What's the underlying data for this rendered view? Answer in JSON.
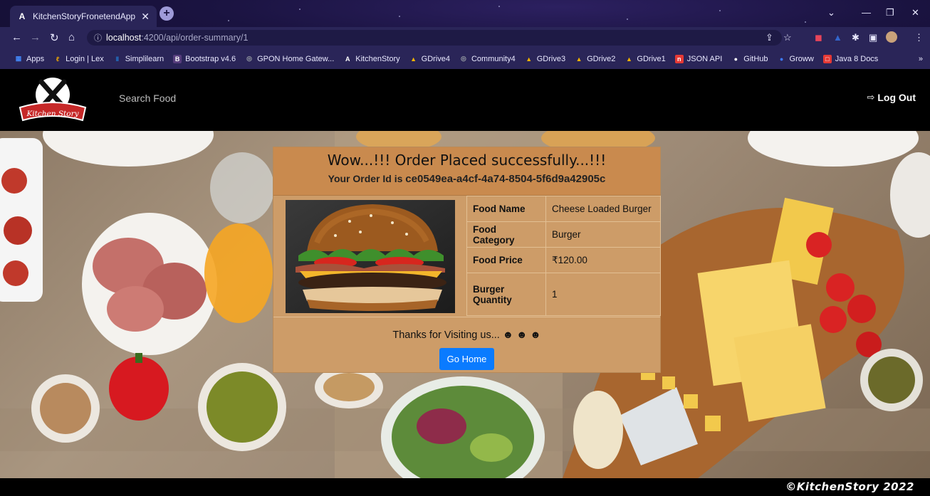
{
  "browser": {
    "tab_title": "KitchenStoryFronetendApp",
    "tab_favicon": "A",
    "url_host": "localhost",
    "url_path": ":4200/api/order-summary/1",
    "bookmarks": [
      {
        "label": "Apps",
        "icon": "apps-grid-icon",
        "color": "#4285f4"
      },
      {
        "label": "Login | Lex",
        "icon": "lex-icon",
        "color": "#f2a900"
      },
      {
        "label": "Simplilearn",
        "icon": "simplilearn-icon",
        "color": "#1e88e5"
      },
      {
        "label": "Bootstrap v4.6",
        "icon": "bootstrap-icon",
        "color": "#563d7c"
      },
      {
        "label": "GPON Home Gatew...",
        "icon": "globe-icon",
        "color": "#9aa0a6"
      },
      {
        "label": "KitchenStory",
        "icon": "angular-icon",
        "color": "#1a1340"
      },
      {
        "label": "GDrive4",
        "icon": "gdrive-icon",
        "color": "#0f9d58"
      },
      {
        "label": "Community4",
        "icon": "globe-icon",
        "color": "#9aa0a6"
      },
      {
        "label": "GDrive3",
        "icon": "gdrive-icon",
        "color": "#0f9d58"
      },
      {
        "label": "GDrive2",
        "icon": "gdrive-icon",
        "color": "#0f9d58"
      },
      {
        "label": "GDrive1",
        "icon": "gdrive-icon",
        "color": "#0f9d58"
      },
      {
        "label": "JSON API",
        "icon": "json-icon",
        "color": "#e53935"
      },
      {
        "label": "GitHub",
        "icon": "github-icon",
        "color": "#ffffff"
      },
      {
        "label": "Groww",
        "icon": "groww-icon",
        "color": "#00b386"
      },
      {
        "label": "Java 8 Docs",
        "icon": "java-docs-icon",
        "color": "#e53935"
      }
    ]
  },
  "header": {
    "logo_text": "Kitchen Story",
    "search_link": "Search Food",
    "logout_label": "Log Out"
  },
  "order": {
    "title": "Wow...!!! Order Placed successfully...!!!",
    "order_id_prefix": "Your Order Id is",
    "order_id": "ce0549ea-a4cf-4a74-8504-5f6d9a42905c",
    "details": [
      {
        "key": "Food Name",
        "value": "Cheese Loaded Burger"
      },
      {
        "key": "Food Category",
        "value": "Burger"
      },
      {
        "key": "Food Price",
        "value": "₹120.00"
      },
      {
        "key": "Burger Quantity",
        "value": "1"
      }
    ],
    "thanks": "Thanks for Visiting us... ☻ ☻ ☻",
    "go_home_label": "Go Home"
  },
  "footer": {
    "copyright": "©KitchenStory 2022"
  },
  "colors": {
    "card_bg": "#cd9c68",
    "card_header": "#c98a4e",
    "button": "#0a7bff"
  }
}
